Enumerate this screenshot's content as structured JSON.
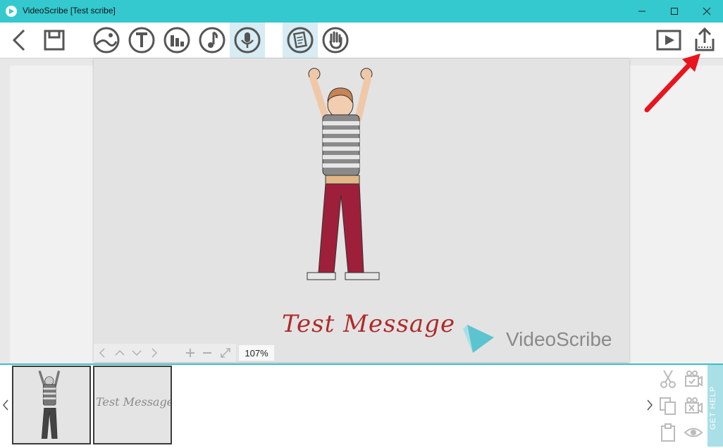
{
  "window": {
    "title": "VideoScribe [Test scribe]"
  },
  "canvas": {
    "message_text": "Test Message",
    "logo_text": "VideoScribe",
    "zoom_level": "107%"
  },
  "thumbnails": {
    "second_text": "Test Message"
  },
  "side_panel": {
    "help_label": "GET HELP"
  },
  "colors": {
    "titlebar": "#34c8cf",
    "accent": "#3cbfc8",
    "message": "#b02a2a",
    "active_tool": "#d7ecf3"
  },
  "icons": {
    "back": "chevron-left-icon",
    "save": "floppy-disk-icon",
    "image": "image-icon",
    "text": "text-icon",
    "chart": "chart-icon",
    "music": "music-note-icon",
    "voice": "microphone-icon",
    "properties": "document-icon",
    "hand": "hand-icon",
    "play": "play-icon",
    "share": "share-export-icon"
  }
}
